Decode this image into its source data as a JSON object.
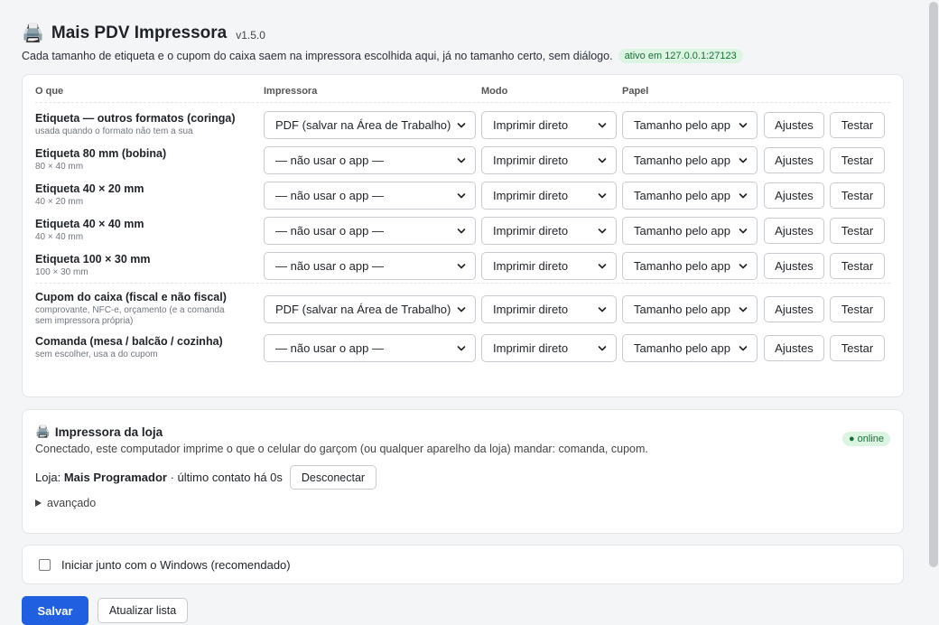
{
  "app": {
    "icon": "printer-icon",
    "title": "Mais PDV Impressora",
    "version": "v1.5.0",
    "subtitle": "Cada tamanho de etiqueta e o cupom do caixa saem na impressora escolhida aqui, já no tamanho certo, sem diálogo.",
    "status_pill": "ativo em 127.0.0.1:27123"
  },
  "table": {
    "headers": {
      "what": "O que",
      "printer": "Impressora",
      "mode": "Modo",
      "paper": "Papel"
    },
    "rows": [
      {
        "title": "Etiqueta — outros formatos (coringa)",
        "sub": "usada quando o formato não tem a sua",
        "printer": "PDF (salvar na Área de Trabalho)",
        "mode": "Imprimir direto",
        "paper": "Tamanho pelo app",
        "settings": "Ajustes",
        "test": "Testar"
      },
      {
        "title": "Etiqueta 80 mm (bobina)",
        "sub": "80 × 40 mm",
        "printer": "— não usar o app —",
        "mode": "Imprimir direto",
        "paper": "Tamanho pelo app",
        "settings": "Ajustes",
        "test": "Testar"
      },
      {
        "title": "Etiqueta 40 × 20 mm",
        "sub": "40 × 20 mm",
        "printer": "— não usar o app —",
        "mode": "Imprimir direto",
        "paper": "Tamanho pelo app",
        "settings": "Ajustes",
        "test": "Testar"
      },
      {
        "title": "Etiqueta 40 × 40 mm",
        "sub": "40 × 40 mm",
        "printer": "— não usar o app —",
        "mode": "Imprimir direto",
        "paper": "Tamanho pelo app",
        "settings": "Ajustes",
        "test": "Testar"
      },
      {
        "title": "Etiqueta 100 × 30 mm",
        "sub": "100 × 30 mm",
        "printer": "— não usar o app —",
        "mode": "Imprimir direto",
        "paper": "Tamanho pelo app",
        "settings": "Ajustes",
        "test": "Testar"
      },
      {
        "title": "Cupom do caixa (fiscal e não fiscal)",
        "sub": "comprovante, NFC-e, orçamento (e a comanda",
        "sub2": "sem impressora própria)",
        "printer": "PDF (salvar na Área de Trabalho)",
        "mode": "Imprimir direto",
        "paper": "Tamanho pelo app",
        "settings": "Ajustes",
        "test": "Testar"
      },
      {
        "title": "Comanda (mesa / balcão / cozinha)",
        "sub": "sem escolher, usa a do cupom",
        "printer": "— não usar o app —",
        "mode": "Imprimir direto",
        "paper": "Tamanho pelo app",
        "settings": "Ajustes",
        "test": "Testar"
      }
    ]
  },
  "loja": {
    "icon": "store-printer-icon",
    "title": "Impressora da loja",
    "desc": "Conectado, este computador imprime o que o celular do garçom (ou qualquer aparelho da loja) mandar: comanda, cupom.",
    "badge": "● online",
    "label": "Loja:",
    "name": "Mais Programador",
    "last_contact": "· último contato há 0s",
    "disconnect": "Desconectar",
    "advanced": "avançado"
  },
  "startup": {
    "label": "Iniciar junto com o Windows (recomendado)",
    "checked": false
  },
  "footer": {
    "save": "Salvar",
    "refresh": "Atualizar lista"
  },
  "colors": {
    "primary": "#1f5fe0",
    "online_bg": "#dcf5e3",
    "online_text": "#1a6d36"
  }
}
